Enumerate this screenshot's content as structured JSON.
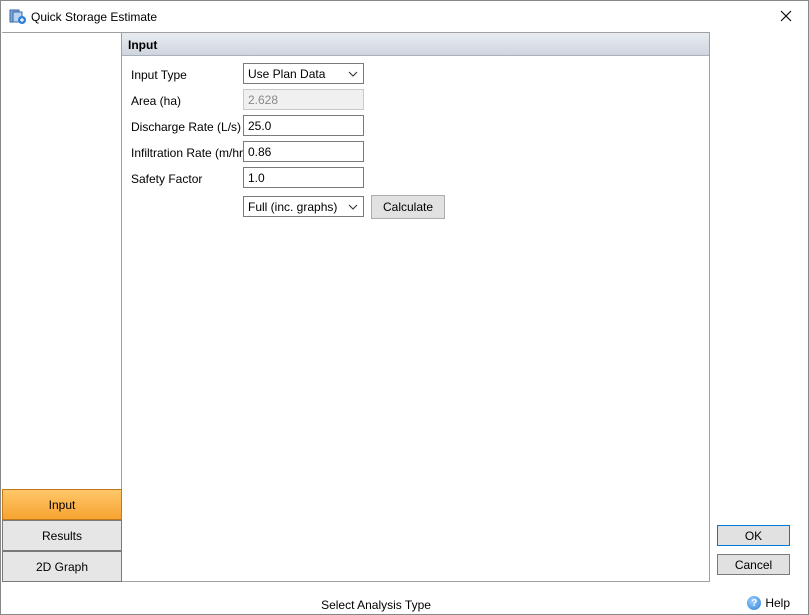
{
  "window": {
    "title": "Quick Storage Estimate"
  },
  "nav": {
    "items": [
      {
        "label": "Input"
      },
      {
        "label": "Results"
      },
      {
        "label": "2D Graph"
      }
    ]
  },
  "input": {
    "header": "Input",
    "input_type_label": "Input Type",
    "input_type_value": "Use Plan Data",
    "area_label": "Area (ha)",
    "area_value": "2.628",
    "discharge_label": "Discharge Rate (L/s)",
    "discharge_value": "25.0",
    "infiltration_label": "Infiltration Rate (m/hr)",
    "infiltration_value": "0.86",
    "safety_label": "Safety Factor",
    "safety_value": "1.0",
    "analysis_value": "Full (inc. graphs)",
    "calculate_label": "Calculate"
  },
  "buttons": {
    "ok_label": "OK",
    "cancel_label": "Cancel"
  },
  "status": {
    "text": "Select Analysis Type",
    "help_label": "Help"
  },
  "colors": {
    "active_nav": "#f7a330",
    "header_bg": "#d8dde5"
  },
  "icons": {
    "app": "storage-app-icon",
    "close": "close-icon",
    "dropdown": "chevron-down-icon",
    "help": "help-icon"
  }
}
